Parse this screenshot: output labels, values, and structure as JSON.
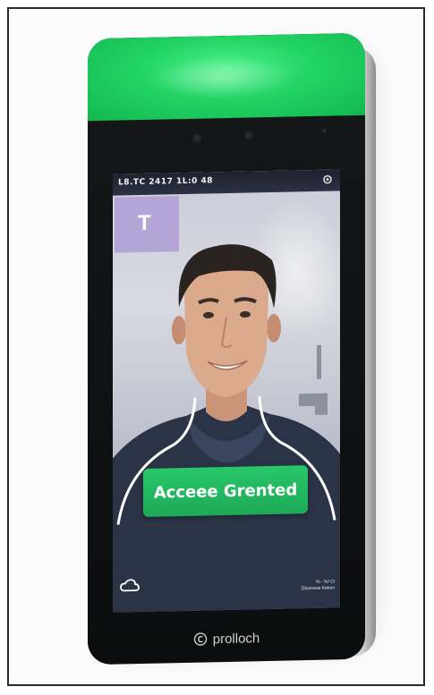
{
  "screen": {
    "status_text": "L8.TC 2417 1L:0 48",
    "tile_glyph": "T",
    "access_button_label": "Acceee Grented",
    "fine_print_line1": "% - %/ Cl",
    "fine_print_line2": "Zlinoneae Kekon"
  },
  "device": {
    "brand_name": "prolloch"
  },
  "colors": {
    "indicator_green": "#22d364",
    "button_green": "#28c76a",
    "bezel": "#0c0d0e"
  },
  "icons": [
    "cloud-icon",
    "settings-icon",
    "brand-logo-icon"
  ]
}
